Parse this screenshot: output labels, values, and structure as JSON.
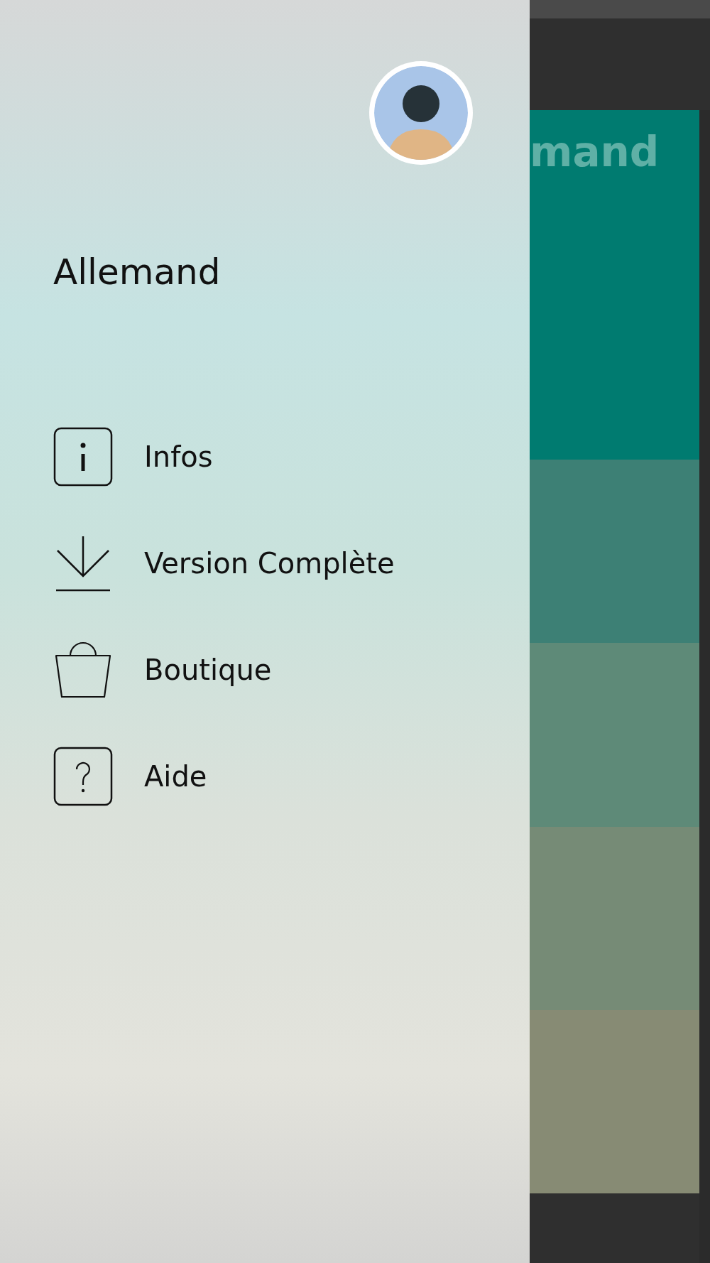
{
  "drawer": {
    "title": "Allemand",
    "items": [
      {
        "kind": "info",
        "label": "Infos"
      },
      {
        "kind": "download",
        "label": "Version Complète"
      },
      {
        "kind": "bag",
        "label": "Boutique"
      },
      {
        "kind": "help",
        "label": "Aide"
      }
    ]
  },
  "background": {
    "header_title": "mand"
  }
}
